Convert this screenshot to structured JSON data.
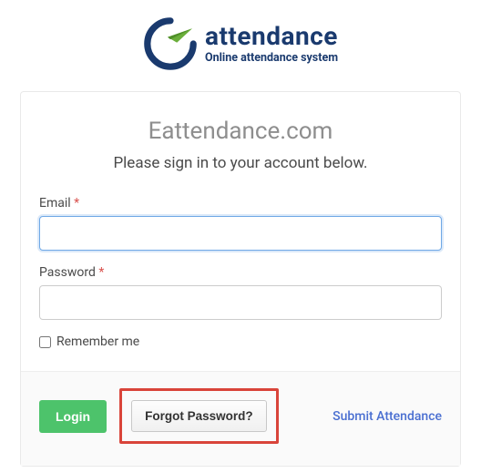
{
  "logo": {
    "title": "attendance",
    "subtitle": "Online attendance system"
  },
  "card": {
    "site_title": "Eattendance.com",
    "subhead": "Please sign in to your account below."
  },
  "form": {
    "email_label": "Email",
    "email_value": "",
    "password_label": "Password",
    "password_value": "",
    "required_mark": "*",
    "remember_label": "Remember me"
  },
  "footer": {
    "login_label": "Login",
    "forgot_label": "Forgot Password?",
    "submit_link": "Submit Attendance"
  }
}
